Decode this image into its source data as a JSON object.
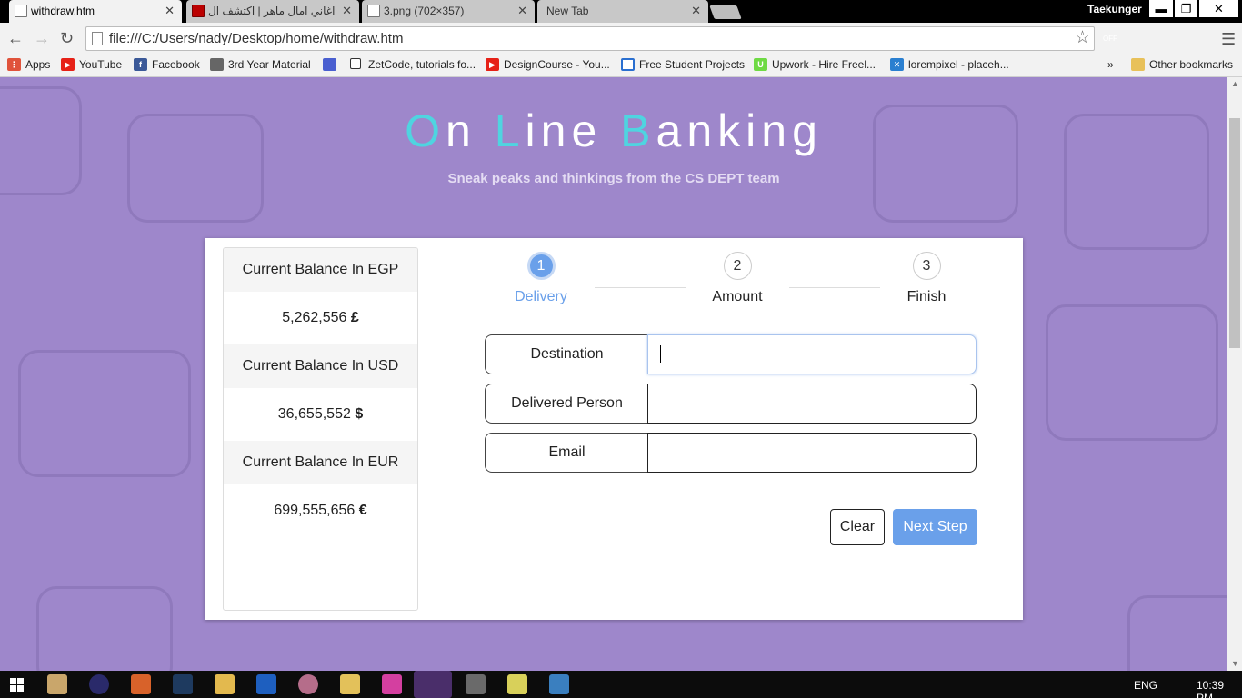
{
  "browser": {
    "tabs": [
      {
        "title": "withdraw.htm",
        "active": true
      },
      {
        "title": "اغاني امال ماهر | اكتشف ال",
        "active": false
      },
      {
        "title": "3.png (702×357)",
        "active": false
      },
      {
        "title": "New Tab",
        "active": false
      }
    ],
    "profile_name": "Taekunger",
    "address": "file:///C:/Users/nady/Desktop/home/withdraw.htm",
    "window_controls": {
      "minimize": "▬",
      "restore": "❐",
      "close": "✕"
    },
    "extensions": [
      {
        "name": "off-extension-icon",
        "label": "OFF",
        "color": "#555555"
      },
      {
        "name": "bug-extension-icon",
        "label": "",
        "color": "#777777"
      },
      {
        "name": "power-extension-icon",
        "label": "",
        "color": "#999999"
      },
      {
        "name": "contrast-extension-icon",
        "label": "",
        "color": "#333333"
      }
    ]
  },
  "bookmarks": {
    "items": [
      {
        "label": "Apps",
        "icon": "apps-grid-icon",
        "color": "#e0533b"
      },
      {
        "label": "YouTube",
        "icon": "youtube-icon",
        "color": "#e62117"
      },
      {
        "label": "Facebook",
        "icon": "facebook-icon",
        "color": "#3b5998"
      },
      {
        "label": "3rd Year Material",
        "icon": "folder-icon",
        "color": "#666666"
      },
      {
        "label": "",
        "icon": "shield-bookmark-icon",
        "color": "#4a5fd0"
      },
      {
        "label": "ZetCode, tutorials fo...",
        "icon": "page-icon",
        "color": "#333333"
      },
      {
        "label": "DesignCourse - You...",
        "icon": "youtube-icon",
        "color": "#e62117"
      },
      {
        "label": "Free Student Projects",
        "icon": "window-icon",
        "color": "#2a6fd0"
      },
      {
        "label": "Upwork - Hire Freel...",
        "icon": "upwork-icon",
        "color": "#6fda44"
      },
      {
        "label": "lorempixel - placeh...",
        "icon": "pixel-icon",
        "color": "#2a7fd0"
      }
    ],
    "overflow": "»",
    "other": "Other bookmarks"
  },
  "page": {
    "title_parts": [
      {
        "text": "O",
        "accent": true
      },
      {
        "text": "n ",
        "accent": false
      },
      {
        "text": "L",
        "accent": true
      },
      {
        "text": "ine ",
        "accent": false
      },
      {
        "text": "B",
        "accent": true
      },
      {
        "text": "anking",
        "accent": false
      }
    ],
    "tagline": "Sneak peaks and thinkings from the CS DEPT team",
    "balances": [
      {
        "label": "Current Balance In EGP",
        "value": "5,262,556",
        "symbol": "£"
      },
      {
        "label": "Current Balance In USD",
        "value": "36,655,552",
        "symbol": "$"
      },
      {
        "label": "Current Balance In EUR",
        "value": "699,555,656",
        "symbol": "€"
      }
    ],
    "steps": [
      {
        "number": "1",
        "label": "Delivery",
        "active": true
      },
      {
        "number": "2",
        "label": "Amount",
        "active": false
      },
      {
        "number": "3",
        "label": "Finish",
        "active": false
      }
    ],
    "fields": [
      {
        "label": "Destination",
        "value": "",
        "focused": true
      },
      {
        "label": "Delivered Person",
        "value": "",
        "focused": false
      },
      {
        "label": "Email",
        "value": "",
        "focused": false
      }
    ],
    "buttons": {
      "clear": "Clear",
      "next": "Next Step"
    },
    "colors": {
      "background": "#9e87cb",
      "accent": "#4fd4e0",
      "primary": "#6aa0ea"
    }
  },
  "taskbar": {
    "language": "ENG",
    "clock": "10:39 PM"
  }
}
